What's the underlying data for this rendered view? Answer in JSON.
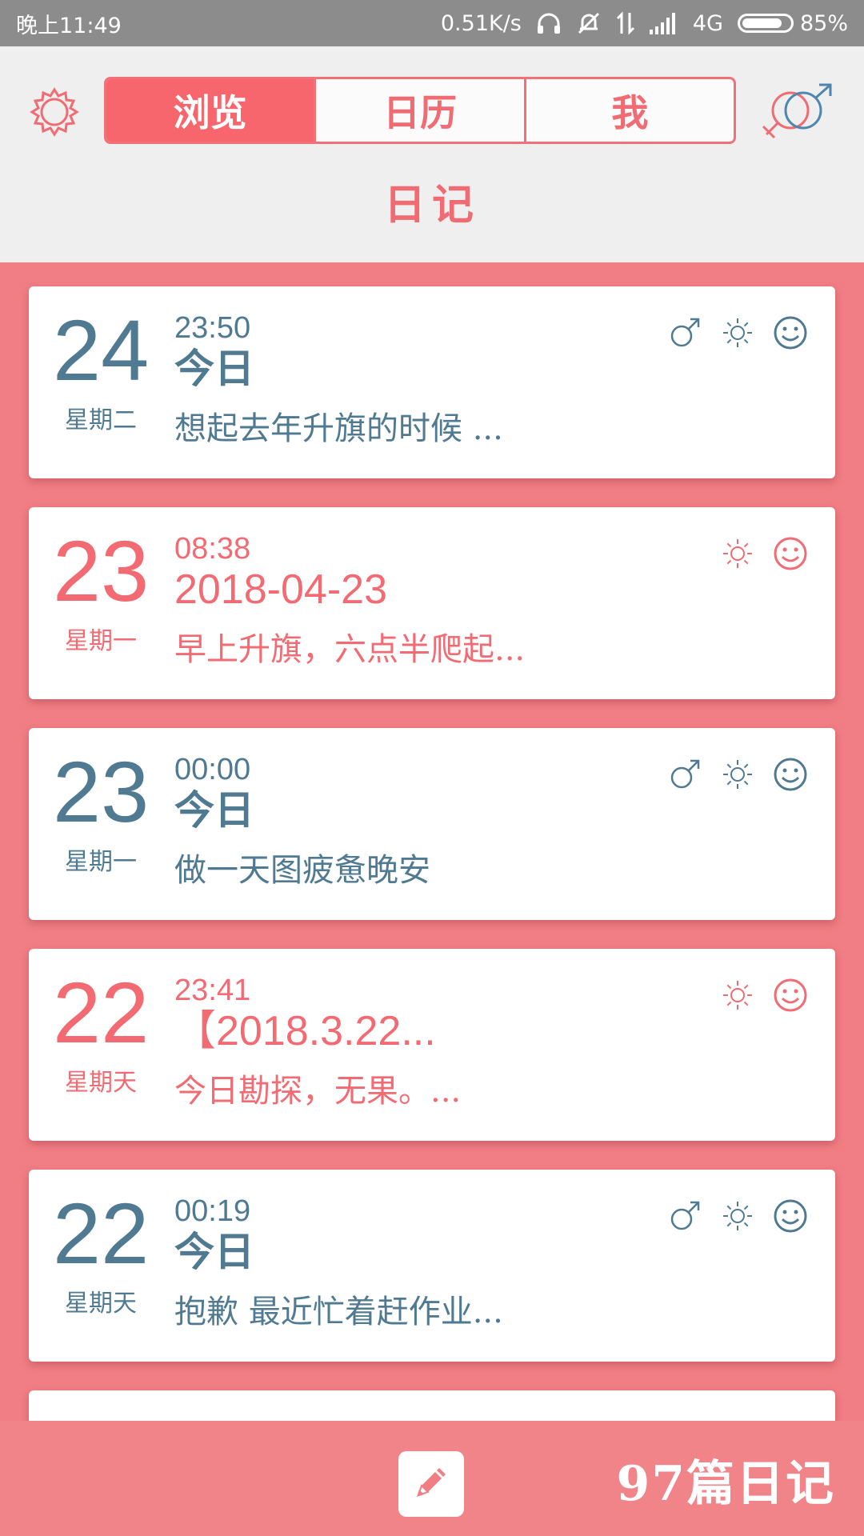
{
  "status_bar": {
    "time": "晚上11:49",
    "net_speed": "0.51K/s",
    "network": "4G",
    "battery": "85%",
    "battery_level": 0.85
  },
  "header": {
    "tabs": [
      {
        "label": "浏览",
        "active": true
      },
      {
        "label": "日历",
        "active": false
      },
      {
        "label": "我",
        "active": false
      }
    ],
    "title": "日记"
  },
  "colors": {
    "accent_pink": "#f26b72",
    "accent_blue": "#4f7a92",
    "list_bg": "#f07e84"
  },
  "entries": [
    {
      "day": "24",
      "weekday": "星期二",
      "time": "23:50",
      "title": "今日",
      "snippet": "想起去年升旗的时候 ...",
      "theme": "blue",
      "icons": [
        "male-icon",
        "sun-icon",
        "smile-icon"
      ]
    },
    {
      "day": "23",
      "weekday": "星期一",
      "time": "08:38",
      "title": "2018-04-23",
      "snippet": "早上升旗，六点半爬起...",
      "theme": "pink",
      "icons": [
        "sun-icon",
        "smile-icon"
      ]
    },
    {
      "day": "23",
      "weekday": "星期一",
      "time": "00:00",
      "title": "今日",
      "snippet": "做一天图疲惫晚安",
      "theme": "blue",
      "icons": [
        "male-icon",
        "sun-icon",
        "smile-icon"
      ]
    },
    {
      "day": "22",
      "weekday": "星期天",
      "time": "23:41",
      "title": "【2018.3.22...",
      "snippet": "今日勘探，无果。...",
      "theme": "pink",
      "icons": [
        "sun-icon",
        "smile-icon"
      ]
    },
    {
      "day": "22",
      "weekday": "星期天",
      "time": "00:19",
      "title": "今日",
      "snippet": "抱歉 最近忙着赶作业...",
      "theme": "blue",
      "icons": [
        "male-icon",
        "sun-icon",
        "smile-icon"
      ]
    }
  ],
  "footer": {
    "count_label": "97篇日记"
  }
}
